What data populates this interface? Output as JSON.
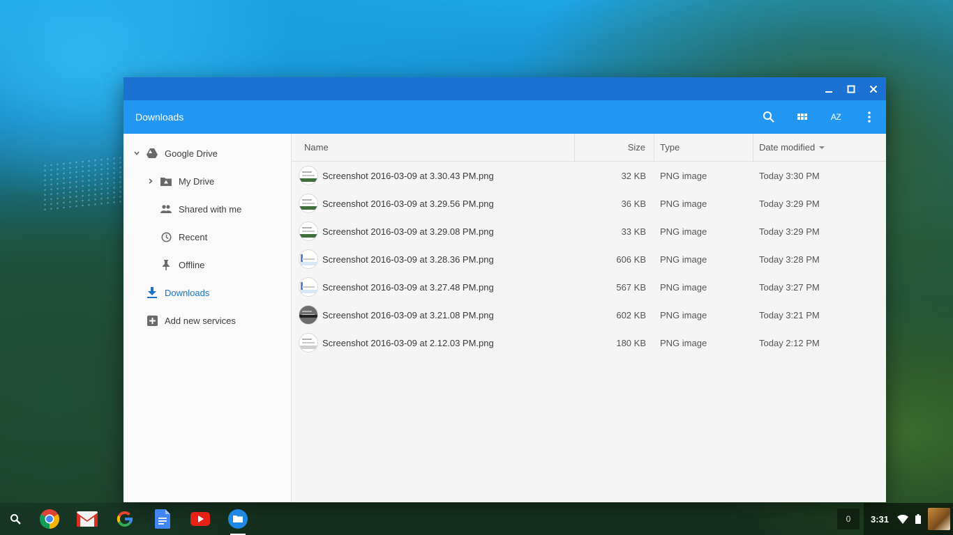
{
  "window": {
    "title": "Downloads",
    "controls": {
      "minimize": "minimize",
      "maximize": "maximize",
      "close": "close"
    }
  },
  "toolbar": {
    "icons": [
      "search-icon",
      "grid-view-icon",
      "sort-az-icon",
      "more-vert-icon"
    ],
    "sort_label": "AZ"
  },
  "sidebar": {
    "items": [
      {
        "label": "Google Drive",
        "icon": "drive-icon",
        "level": 0,
        "expander": "expanded"
      },
      {
        "label": "My Drive",
        "icon": "drive-folder-icon",
        "level": 1,
        "expander": "collapsed"
      },
      {
        "label": "Shared with me",
        "icon": "people-icon",
        "level": 1
      },
      {
        "label": "Recent",
        "icon": "clock-icon",
        "level": 1
      },
      {
        "label": "Offline",
        "icon": "pin-icon",
        "level": 1
      },
      {
        "label": "Downloads",
        "icon": "download-icon",
        "level": 0,
        "active": true
      },
      {
        "label": "Add new services",
        "icon": "add-box-icon",
        "level": 0
      }
    ]
  },
  "table": {
    "columns": {
      "name": "Name",
      "size": "Size",
      "type": "Type",
      "date": "Date modified"
    },
    "rows": [
      {
        "name": "Screenshot 2016-03-09 at 3.30.43 PM.png",
        "size": "32 KB",
        "type": "PNG image",
        "date": "Today 3:30 PM"
      },
      {
        "name": "Screenshot 2016-03-09 at 3.29.56 PM.png",
        "size": "36 KB",
        "type": "PNG image",
        "date": "Today 3:29 PM"
      },
      {
        "name": "Screenshot 2016-03-09 at 3.29.08 PM.png",
        "size": "33 KB",
        "type": "PNG image",
        "date": "Today 3:29 PM"
      },
      {
        "name": "Screenshot 2016-03-09 at 3.28.36 PM.png",
        "size": "606 KB",
        "type": "PNG image",
        "date": "Today 3:28 PM"
      },
      {
        "name": "Screenshot 2016-03-09 at 3.27.48 PM.png",
        "size": "567 KB",
        "type": "PNG image",
        "date": "Today 3:27 PM"
      },
      {
        "name": "Screenshot 2016-03-09 at 3.21.08 PM.png",
        "size": "602 KB",
        "type": "PNG image",
        "date": "Today 3:21 PM"
      },
      {
        "name": "Screenshot 2016-03-09 at 2.12.03 PM.png",
        "size": "180 KB",
        "type": "PNG image",
        "date": "Today 2:12 PM"
      }
    ]
  },
  "shelf": {
    "apps": [
      "chrome-icon",
      "gmail-icon",
      "google-search-icon",
      "docs-icon",
      "youtube-icon",
      "files-icon"
    ],
    "notification_count": "0",
    "time": "3:31"
  },
  "colors": {
    "titlebar": "#1b72d2",
    "appbar": "#2196f3",
    "accent": "#1a73c8"
  }
}
